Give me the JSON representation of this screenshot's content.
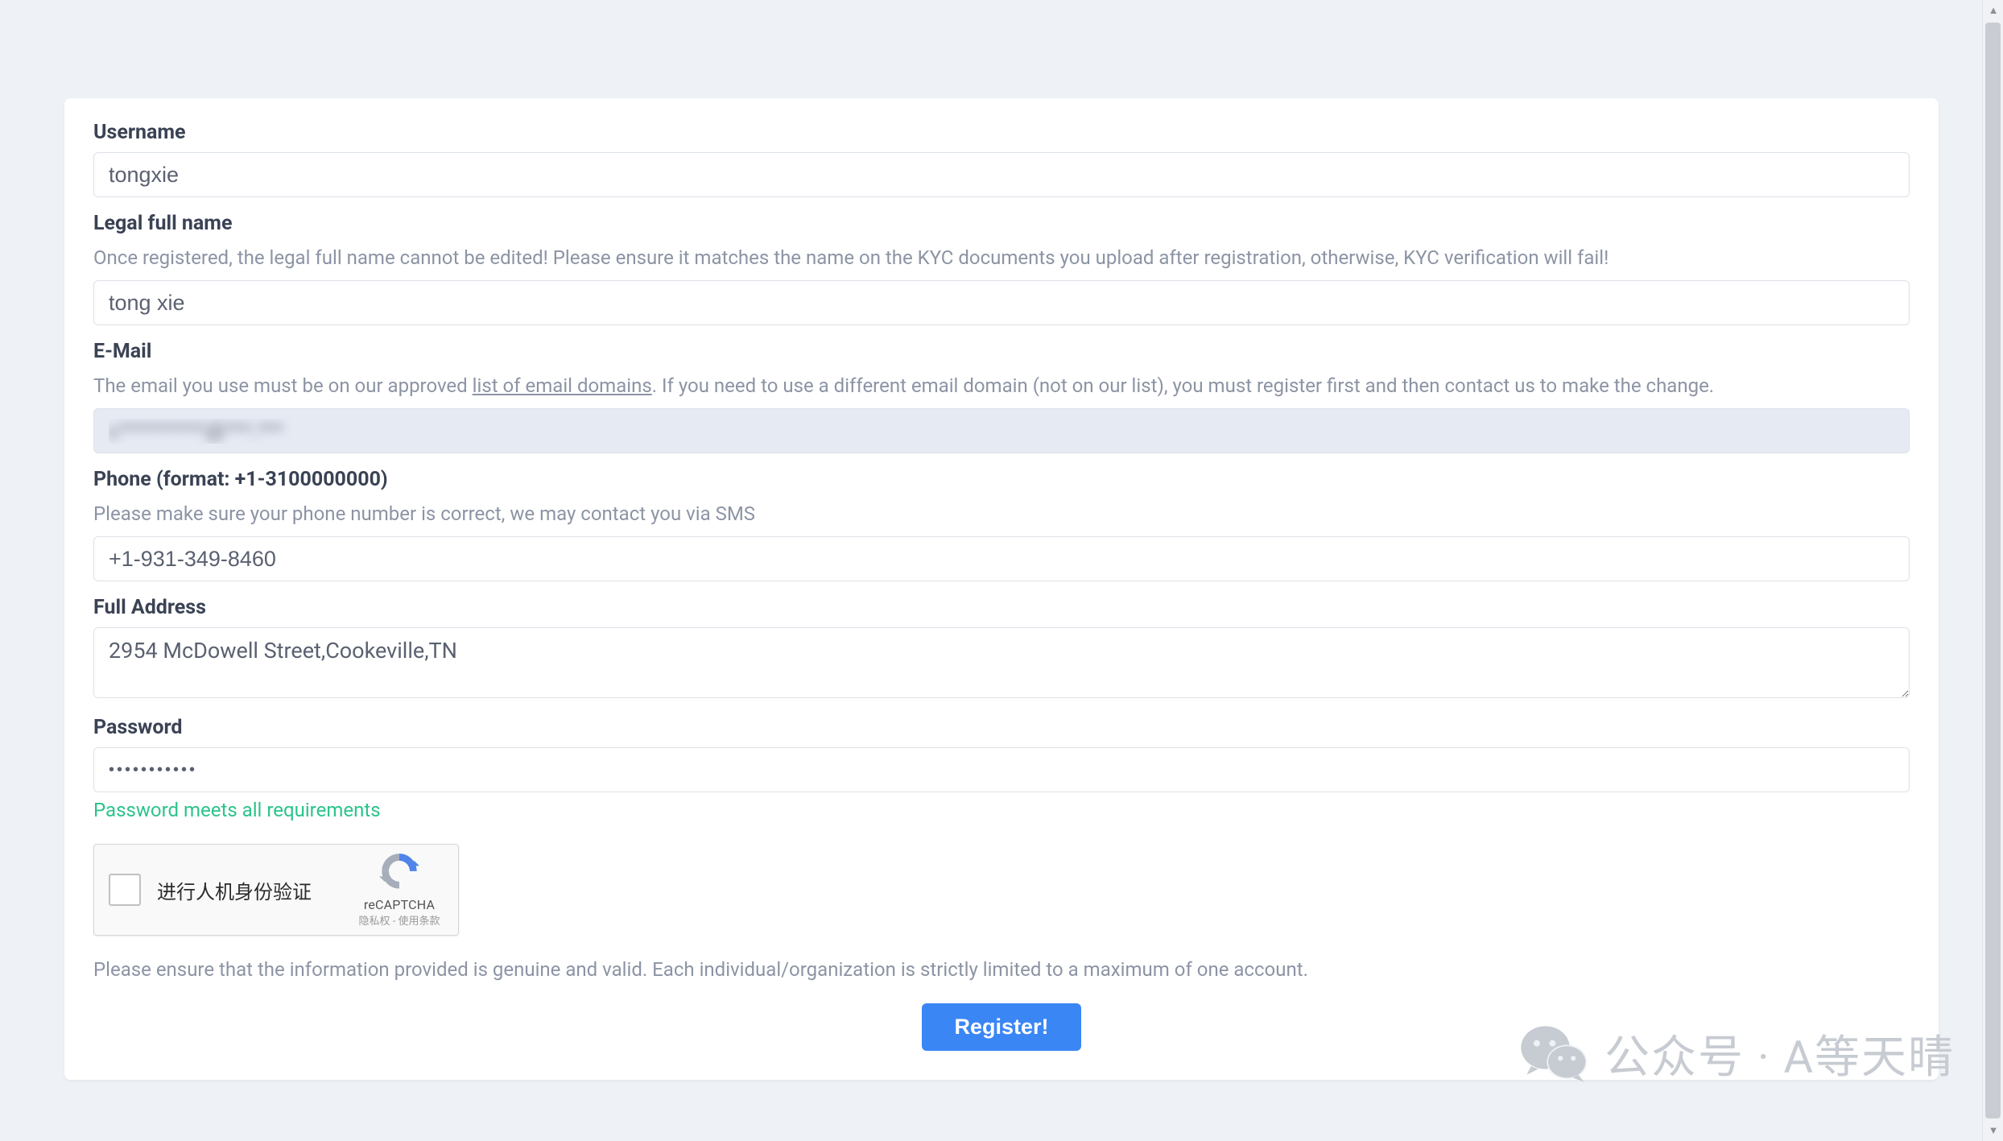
{
  "form": {
    "username": {
      "label": "Username",
      "value": "tongxie"
    },
    "legalName": {
      "label": "Legal full name",
      "helper": "Once registered, the legal full name cannot be edited! Please ensure it matches the name on the KYC documents you upload after registration, otherwise, KYC verification will fail!",
      "value": "tong xie"
    },
    "email": {
      "label": "E-Mail",
      "helperPrefix": "The email you use must be on our approved ",
      "helperLink": "list of email domains",
      "helperSuffix": ". If you need to use a different email domain (not on our list), you must register first and then contact us to make the change.",
      "value": "c**********@***.***"
    },
    "phone": {
      "label": "Phone (format: +1-3100000000)",
      "helper": "Please make sure your phone number is correct, we may contact you via SMS",
      "value": "+1-931-349-8460"
    },
    "address": {
      "label": "Full Address",
      "value": "2954 McDowell Street,Cookeville,TN"
    },
    "password": {
      "label": "Password",
      "value": "•••••••••••",
      "hint": "Password meets all requirements"
    },
    "recaptcha": {
      "label": "进行人机身份验证",
      "brand": "reCAPTCHA",
      "terms": "隐私权 - 使用条款"
    },
    "disclaimer": "Please ensure that the information provided is genuine and valid. Each individual/organization is strictly limited to a maximum of one account.",
    "submitLabel": "Register!"
  },
  "watermark": {
    "text": "公众号 · A等天晴"
  }
}
